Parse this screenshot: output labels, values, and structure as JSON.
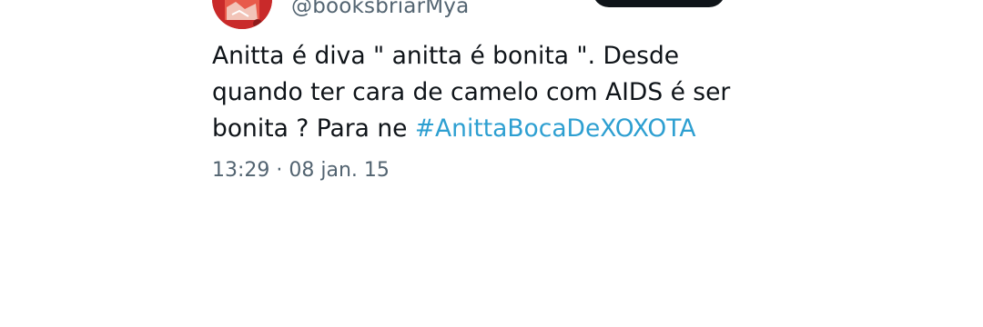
{
  "author": {
    "handle": "@booksbriarMya"
  },
  "tweet": {
    "line1": "Anitta é diva \" anitta é bonita \".  Desde",
    "line2": "quando ter cara de camelo com AIDS é ser",
    "line3_text": "bonita ?  Para ne  ",
    "hashtag": "#AnittaBocaDeXOXOTA",
    "timestamp": "13:29 · 08 jan. 15"
  },
  "colors": {
    "text": "#0f1419",
    "secondary": "#536471",
    "hashtag": "#2d9fd1",
    "button_bg": "#0f1419",
    "avatar": "#c92a2a"
  },
  "icons": {
    "avatar": "profile-avatar"
  }
}
